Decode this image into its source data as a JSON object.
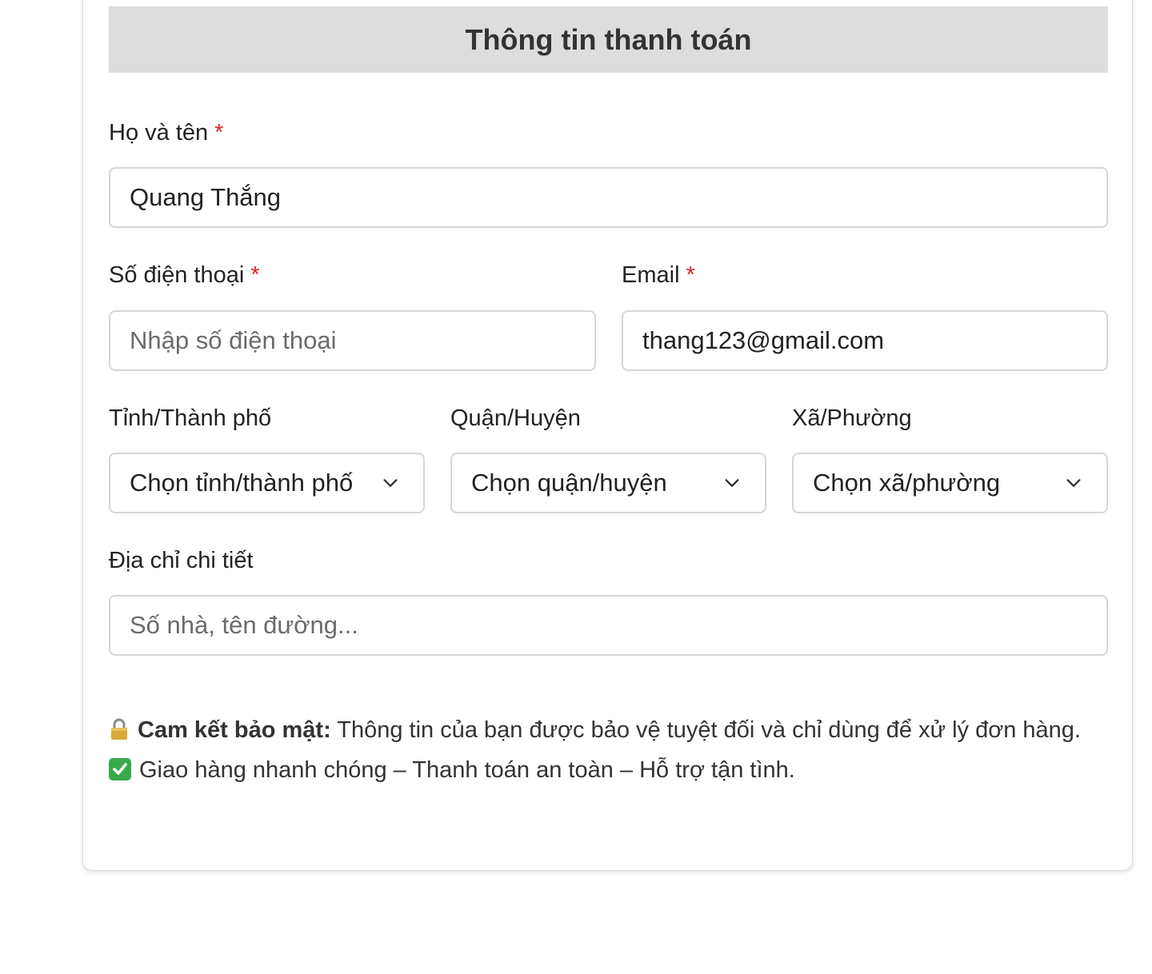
{
  "section": {
    "title": "Thông tin thanh toán"
  },
  "fields": {
    "full_name": {
      "label": "Họ và tên",
      "required_mark": "*",
      "value": "Quang Thắng"
    },
    "phone": {
      "label": "Số điện thoại",
      "required_mark": "*",
      "placeholder": "Nhập số điện thoại",
      "value": ""
    },
    "email": {
      "label": "Email",
      "required_mark": "*",
      "value": "thang123@gmail.com"
    },
    "province": {
      "label": "Tỉnh/Thành phố",
      "selected": "Chọn tỉnh/thành phố"
    },
    "district": {
      "label": "Quận/Huyện",
      "selected": "Chọn quận/huyện"
    },
    "ward": {
      "label": "Xã/Phường",
      "selected": "Chọn xã/phường"
    },
    "address": {
      "label": "Địa chỉ chi tiết",
      "placeholder": "Số nhà, tên đường...",
      "value": ""
    }
  },
  "notes": {
    "security_title": "Cam kết bảo mật:",
    "security_text": " Thông tin của bạn được bảo vệ tuyệt đối và chỉ dùng để xử lý đơn hàng.",
    "delivery_text": "Giao hàng nhanh chóng – Thanh toán an toàn – Hỗ trợ tận tình."
  },
  "icons": {
    "security": "lock-icon",
    "delivery": "check-mark-icon",
    "select": "chevron-down-icon"
  },
  "colors": {
    "header_bg": "#dddddd",
    "required": "#e02424",
    "border": "#d6d6d6",
    "check_green": "#3aa94b"
  }
}
